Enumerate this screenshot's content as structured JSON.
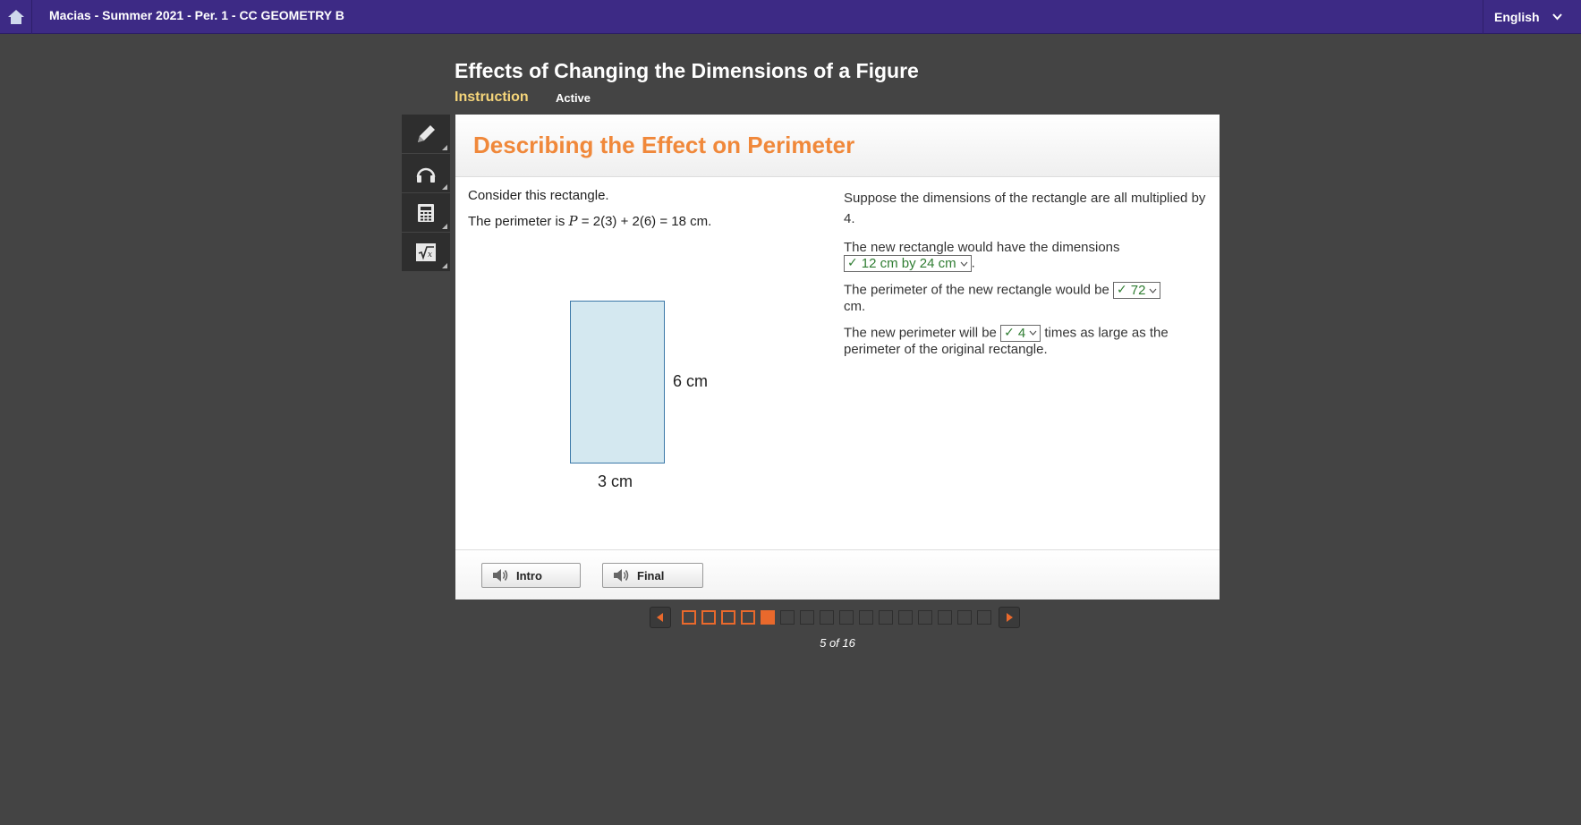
{
  "topbar": {
    "course_title": "Macias - Summer 2021 - Per. 1 - CC GEOMETRY B",
    "language": "English"
  },
  "lesson": {
    "title": "Effects of Changing the Dimensions of a Figure",
    "tab": "Instruction",
    "status": "Active"
  },
  "tools": [
    "pencil-icon",
    "headphones-icon",
    "calculator-icon",
    "formula-icon"
  ],
  "card": {
    "title": "Describing the Effect on Perimeter",
    "left": {
      "line1": "Consider this rectangle.",
      "line2_prefix": "The perimeter is ",
      "line2_var": "P",
      "line2_suffix": " = 2(3) + 2(6) = 18 cm.",
      "height_label": "6 cm",
      "width_label": "3 cm"
    },
    "right": {
      "para1": "Suppose the dimensions of the rectangle are all multiplied by 4.",
      "para2_prefix": "The new rectangle would have the dimensions",
      "para2_answer": "12 cm by 24 cm",
      "para2_suffix": ".",
      "para3_prefix": "The perimeter of the new rectangle would be",
      "para3_answer": "72",
      "para3_suffix": "cm.",
      "para4_prefix": "The new perimeter will be",
      "para4_answer": "4",
      "para4_suffix": "times as large as the perimeter of the original rectangle.",
      "check_mark": "✓"
    },
    "footer": {
      "intro_label": "Intro",
      "final_label": "Final"
    }
  },
  "pager": {
    "current": 5,
    "total": 16,
    "label": "5 of 16",
    "accent_color": "#e9692c"
  }
}
